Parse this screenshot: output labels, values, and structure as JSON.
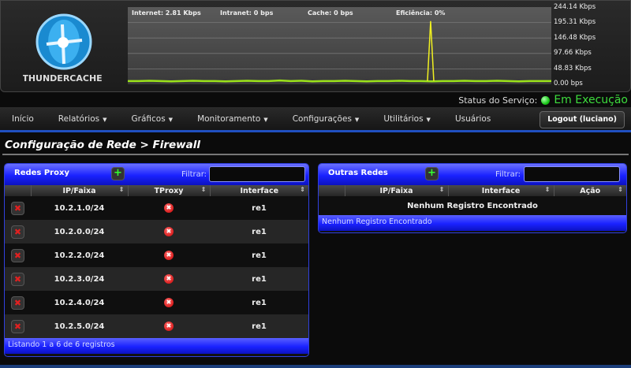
{
  "brand": {
    "name": "THUNDERCACHE"
  },
  "graph": {
    "labels": {
      "internet": "Internet: 2.81 Kbps",
      "intranet": "Intranet: 0 bps",
      "cache": "Cache: 0 bps",
      "efficiency": "Eficiência: 0%"
    },
    "y_ticks": [
      "244.14 Kbps",
      "195.31 Kbps",
      "146.48 Kbps",
      "97.66 Kbps",
      "48.83 Kbps",
      "0.00 bps"
    ],
    "y_max_kbps": 244.14,
    "internet_kbps": [
      3,
      3,
      4,
      3,
      2,
      3,
      4,
      3,
      3,
      2,
      3,
      4,
      3,
      3,
      5,
      3,
      4,
      2,
      3,
      3,
      4,
      3,
      2,
      3,
      3,
      4,
      3,
      3,
      2,
      3,
      3,
      4,
      3,
      3,
      4,
      3,
      2,
      3,
      3,
      3
    ],
    "spike": {
      "index_fraction": 0.715,
      "value_kbps": 205
    },
    "colors": {
      "internet": "#9be21a",
      "spike": "#f0f020"
    }
  },
  "status": {
    "label": "Status do Serviço:",
    "value": "Em Execução"
  },
  "nav": {
    "items": [
      {
        "label": "Início",
        "caret": false
      },
      {
        "label": "Relatórios",
        "caret": true
      },
      {
        "label": "Gráficos",
        "caret": true
      },
      {
        "label": "Monitoramento",
        "caret": true
      },
      {
        "label": "Configurações",
        "caret": true
      },
      {
        "label": "Utilitários",
        "caret": true
      },
      {
        "label": "Usuários",
        "caret": false
      }
    ],
    "logout": "Logout (luciano)"
  },
  "page_title": "Configuração de Rede > Firewall",
  "proxy": {
    "title": "Redes Proxy",
    "add": "+",
    "filter_label": "Filtrar:",
    "filter_value": "",
    "columns": [
      "",
      "IP/Faixa",
      "TProxy",
      "Interface"
    ],
    "rows": [
      {
        "ip": "10.2.1.0/24",
        "iface": "re1"
      },
      {
        "ip": "10.2.0.0/24",
        "iface": "re1"
      },
      {
        "ip": "10.2.2.0/24",
        "iface": "re1"
      },
      {
        "ip": "10.2.3.0/24",
        "iface": "re1"
      },
      {
        "ip": "10.2.4.0/24",
        "iface": "re1"
      },
      {
        "ip": "10.2.5.0/24",
        "iface": "re1"
      }
    ],
    "footer": "Listando 1 a 6 de 6 registros"
  },
  "others": {
    "title": "Outras Redes",
    "add": "+",
    "filter_label": "Filtrar:",
    "filter_value": "",
    "columns": [
      "",
      "IP/Faixa",
      "Interface",
      "Ação"
    ],
    "empty": "Nenhum Registro Encontrado",
    "footer": "Nenhum Registro Encontrado"
  }
}
